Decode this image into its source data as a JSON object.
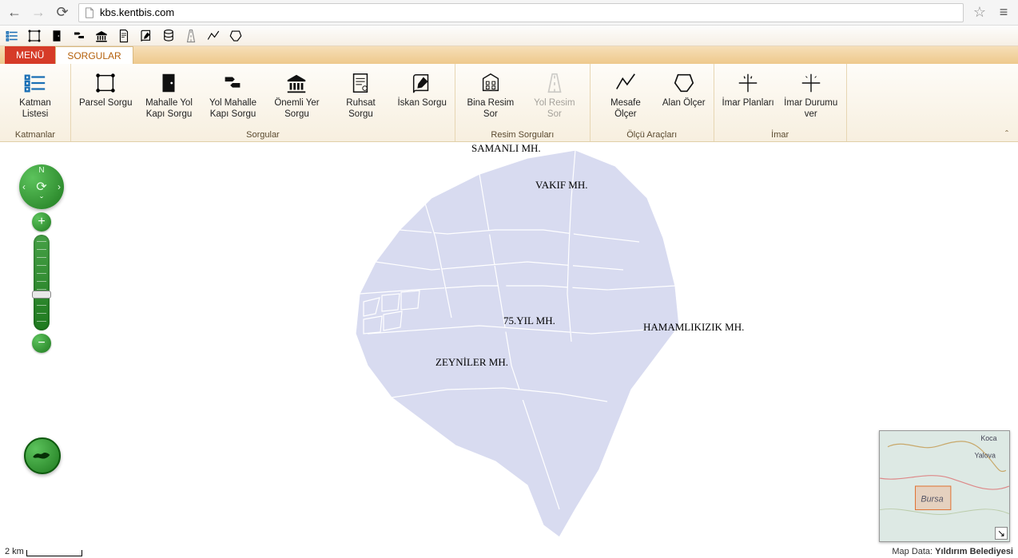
{
  "browser": {
    "url": "kbs.kentbis.com"
  },
  "tabs": {
    "menu": "MENÜ",
    "sorgular": "SORGULAR"
  },
  "ribbon": {
    "groups": {
      "katmanlar": {
        "label": "Katmanlar",
        "items": {
          "katman_listesi": "Katman Listesi"
        }
      },
      "sorgular": {
        "label": "Sorgular",
        "items": {
          "parsel_sorgu": "Parsel Sorgu",
          "mahalle_yol_kapi": "Mahalle Yol Kapı Sorgu",
          "yol_mahalle_kapi": "Yol Mahalle Kapı Sorgu",
          "onemli_yer": "Önemli Yer Sorgu",
          "ruhsat_sorgu": "Ruhsat Sorgu",
          "iskan_sorgu": "İskan Sorgu"
        }
      },
      "resim": {
        "label": "Resim Sorguları",
        "items": {
          "bina_resim": "Bina Resim Sor",
          "yol_resim": "Yol Resim Sor"
        }
      },
      "olcu": {
        "label": "Ölçü Araçları",
        "items": {
          "mesafe": "Mesafe Ölçer",
          "alan": "Alan Ölçer"
        }
      },
      "imar": {
        "label": "İmar",
        "items": {
          "imar_planlari": "İmar Planları",
          "imar_durumu": "İmar Durumu ver"
        }
      }
    }
  },
  "map": {
    "labels": {
      "samanli": "SAMANLI MH.",
      "vakif": "VAKIF MH.",
      "yil75": "75.YIL MH.",
      "hamamlikizik": "HAMAMLIKIZIK MH.",
      "zeyniler": "ZEYNİLER MH."
    },
    "compass_n": "N",
    "scale": "2 km",
    "attribution_prefix": "Map Data: ",
    "attribution_source": "Yıldırım Belediyesi",
    "overview": {
      "labels": {
        "koca": "Koca",
        "yalova": "Yalova",
        "bursa": "Bursa"
      }
    }
  }
}
